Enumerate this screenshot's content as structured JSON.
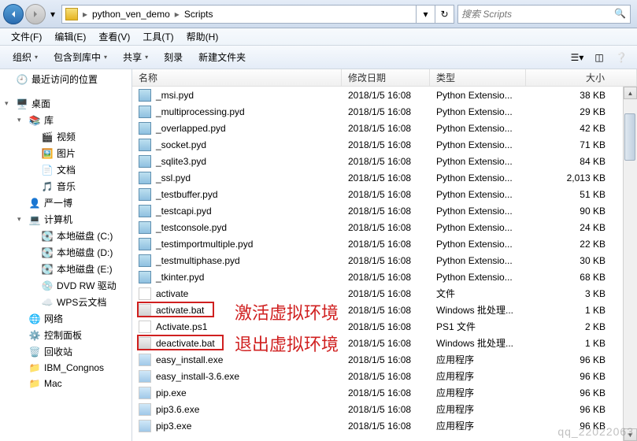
{
  "breadcrumb": {
    "seg1": "python_ven_demo",
    "seg2": "Scripts"
  },
  "search": {
    "placeholder": "搜索 Scripts"
  },
  "menu": {
    "file": "文件(F)",
    "edit": "编辑(E)",
    "view": "查看(V)",
    "tools": "工具(T)",
    "help": "帮助(H)"
  },
  "toolbar": {
    "organize": "组织",
    "include": "包含到库中",
    "share": "共享",
    "burn": "刻录",
    "newfolder": "新建文件夹"
  },
  "tree": {
    "recent": "最近访问的位置",
    "desktop": "桌面",
    "library": "库",
    "video": "视频",
    "picture": "图片",
    "docs": "文档",
    "music": "音乐",
    "user": "严一博",
    "computer": "计算机",
    "diskc": "本地磁盘 (C:)",
    "diskd": "本地磁盘 (D:)",
    "diske": "本地磁盘 (E:)",
    "dvd": "DVD RW 驱动",
    "wps": "WPS云文档",
    "network": "网络",
    "control": "控制面板",
    "recycle": "回收站",
    "ibm": "IBM_Congnos",
    "mac": "Mac"
  },
  "columns": {
    "name": "名称",
    "date": "修改日期",
    "type": "类型",
    "size": "大小"
  },
  "files": [
    {
      "name": "_msi.pyd",
      "date": "2018/1/5 16:08",
      "type": "Python Extensio...",
      "size": "38 KB",
      "icon": "pyd"
    },
    {
      "name": "_multiprocessing.pyd",
      "date": "2018/1/5 16:08",
      "type": "Python Extensio...",
      "size": "29 KB",
      "icon": "pyd"
    },
    {
      "name": "_overlapped.pyd",
      "date": "2018/1/5 16:08",
      "type": "Python Extensio...",
      "size": "42 KB",
      "icon": "pyd"
    },
    {
      "name": "_socket.pyd",
      "date": "2018/1/5 16:08",
      "type": "Python Extensio...",
      "size": "71 KB",
      "icon": "pyd"
    },
    {
      "name": "_sqlite3.pyd",
      "date": "2018/1/5 16:08",
      "type": "Python Extensio...",
      "size": "84 KB",
      "icon": "pyd"
    },
    {
      "name": "_ssl.pyd",
      "date": "2018/1/5 16:08",
      "type": "Python Extensio...",
      "size": "2,013 KB",
      "icon": "pyd"
    },
    {
      "name": "_testbuffer.pyd",
      "date": "2018/1/5 16:08",
      "type": "Python Extensio...",
      "size": "51 KB",
      "icon": "pyd"
    },
    {
      "name": "_testcapi.pyd",
      "date": "2018/1/5 16:08",
      "type": "Python Extensio...",
      "size": "90 KB",
      "icon": "pyd"
    },
    {
      "name": "_testconsole.pyd",
      "date": "2018/1/5 16:08",
      "type": "Python Extensio...",
      "size": "24 KB",
      "icon": "pyd"
    },
    {
      "name": "_testimportmultiple.pyd",
      "date": "2018/1/5 16:08",
      "type": "Python Extensio...",
      "size": "22 KB",
      "icon": "pyd"
    },
    {
      "name": "_testmultiphase.pyd",
      "date": "2018/1/5 16:08",
      "type": "Python Extensio...",
      "size": "30 KB",
      "icon": "pyd"
    },
    {
      "name": "_tkinter.pyd",
      "date": "2018/1/5 16:08",
      "type": "Python Extensio...",
      "size": "68 KB",
      "icon": "pyd"
    },
    {
      "name": "activate",
      "date": "2018/1/5 16:08",
      "type": "文件",
      "size": "3 KB",
      "icon": "txt"
    },
    {
      "name": "activate.bat",
      "date": "2018/1/5 16:08",
      "type": "Windows 批处理...",
      "size": "1 KB",
      "icon": "bat"
    },
    {
      "name": "Activate.ps1",
      "date": "2018/1/5 16:08",
      "type": "PS1 文件",
      "size": "2 KB",
      "icon": "txt"
    },
    {
      "name": "deactivate.bat",
      "date": "2018/1/5 16:08",
      "type": "Windows 批处理...",
      "size": "1 KB",
      "icon": "bat"
    },
    {
      "name": "easy_install.exe",
      "date": "2018/1/5 16:08",
      "type": "应用程序",
      "size": "96 KB",
      "icon": "exe"
    },
    {
      "name": "easy_install-3.6.exe",
      "date": "2018/1/5 16:08",
      "type": "应用程序",
      "size": "96 KB",
      "icon": "exe"
    },
    {
      "name": "pip.exe",
      "date": "2018/1/5 16:08",
      "type": "应用程序",
      "size": "96 KB",
      "icon": "exe"
    },
    {
      "name": "pip3.6.exe",
      "date": "2018/1/5 16:08",
      "type": "应用程序",
      "size": "96 KB",
      "icon": "exe"
    },
    {
      "name": "pip3.exe",
      "date": "2018/1/5 16:08",
      "type": "应用程序",
      "size": "96 KB",
      "icon": "exe"
    }
  ],
  "annotations": {
    "activate": "激活虚拟环境",
    "deactivate": "退出虚拟环境"
  },
  "watermark": "qq_22022063"
}
